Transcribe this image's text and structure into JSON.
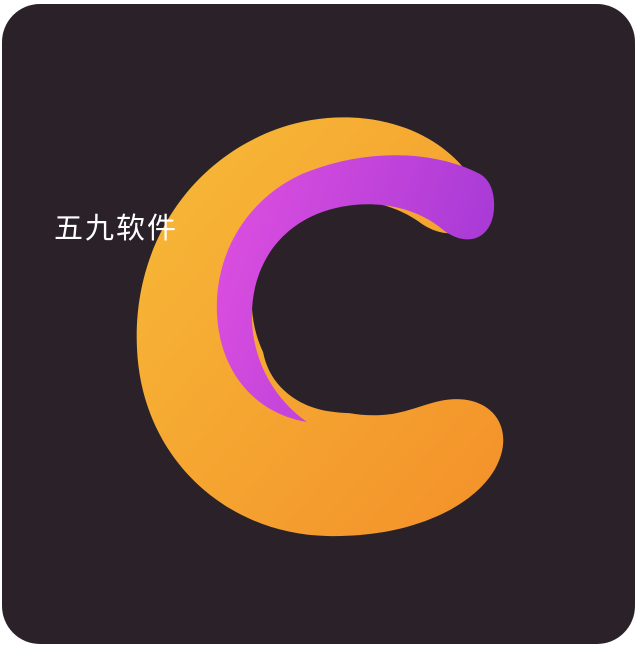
{
  "watermark": {
    "text": "五九软件"
  },
  "logo": {
    "background_color": "#2a2228",
    "gradient_light": "#f7bb38",
    "gradient_dark": "#f3902a",
    "accent_light": "#e050e0",
    "accent_dark": "#a83ad6"
  }
}
